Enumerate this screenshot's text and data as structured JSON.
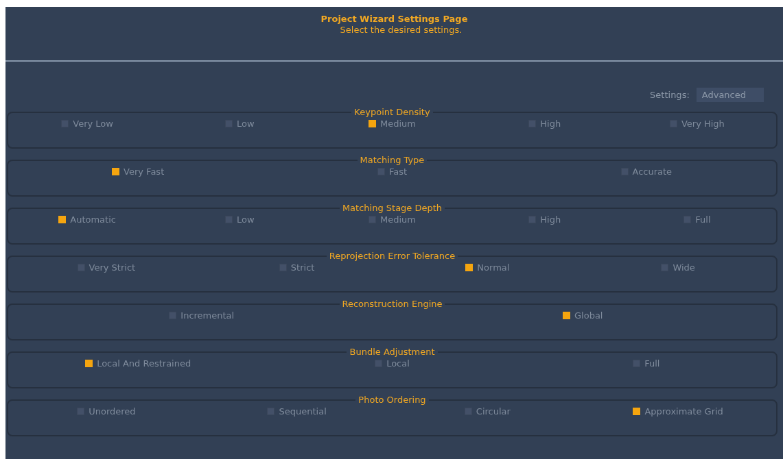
{
  "header": {
    "title": "Project Wizard Settings Page",
    "subtitle": "Select the desired settings."
  },
  "settings": {
    "label": "Settings:",
    "value": "Advanced"
  },
  "groups": [
    {
      "title": "Keypoint Density",
      "options": [
        {
          "label": "Very Low",
          "selected": false
        },
        {
          "label": "Low",
          "selected": false
        },
        {
          "label": "Medium",
          "selected": true
        },
        {
          "label": "High",
          "selected": false
        },
        {
          "label": "Very High",
          "selected": false
        }
      ]
    },
    {
      "title": "Matching Type",
      "options": [
        {
          "label": "Very Fast",
          "selected": true
        },
        {
          "label": "Fast",
          "selected": false
        },
        {
          "label": "Accurate",
          "selected": false
        }
      ]
    },
    {
      "title": "Matching Stage Depth",
      "options": [
        {
          "label": "Automatic",
          "selected": true
        },
        {
          "label": "Low",
          "selected": false
        },
        {
          "label": "Medium",
          "selected": false
        },
        {
          "label": "High",
          "selected": false
        },
        {
          "label": "Full",
          "selected": false
        }
      ]
    },
    {
      "title": "Reprojection Error Tolerance",
      "options": [
        {
          "label": "Very Strict",
          "selected": false
        },
        {
          "label": "Strict",
          "selected": false
        },
        {
          "label": "Normal",
          "selected": true
        },
        {
          "label": "Wide",
          "selected": false
        }
      ]
    },
    {
      "title": "Reconstruction Engine",
      "options": [
        {
          "label": "Incremental",
          "selected": false
        },
        {
          "label": "Global",
          "selected": true
        }
      ]
    },
    {
      "title": "Bundle Adjustment",
      "options": [
        {
          "label": "Local And Restrained",
          "selected": true
        },
        {
          "label": "Local",
          "selected": false
        },
        {
          "label": "Full",
          "selected": false
        }
      ]
    },
    {
      "title": "Photo Ordering",
      "options": [
        {
          "label": "Unordered",
          "selected": false
        },
        {
          "label": "Sequential",
          "selected": false
        },
        {
          "label": "Circular",
          "selected": false
        },
        {
          "label": "Approximate Grid",
          "selected": true
        }
      ]
    }
  ]
}
